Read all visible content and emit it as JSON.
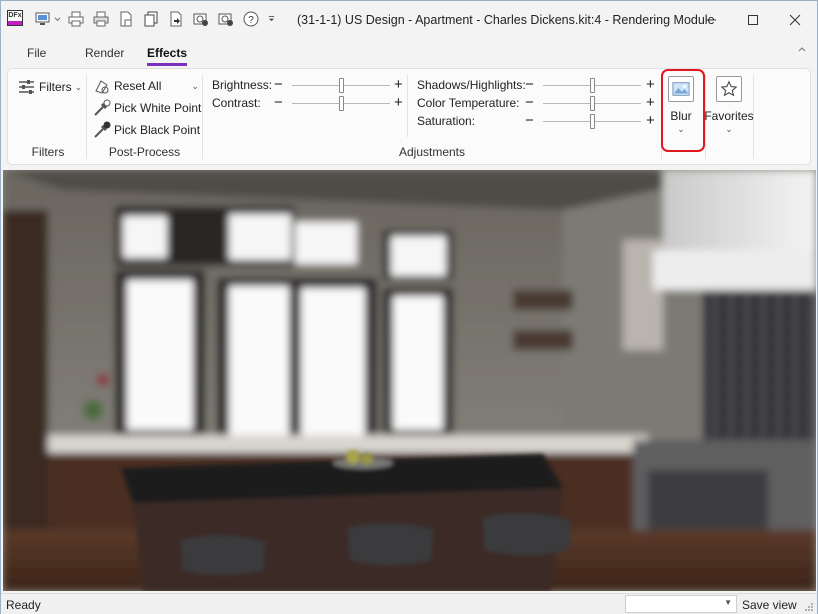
{
  "app": {
    "logo_text": "DFx",
    "window_title": "(31-1-1) US Design - Apartment - Charles Dickens.kit:4 - Rendering Module"
  },
  "quick_access": {
    "icons": [
      "monitor-capture-icon",
      "print-icon",
      "print-setup-icon",
      "document-icon",
      "copy-icon",
      "export-icon",
      "camera-settings-icon",
      "camera-add-icon",
      "help-icon",
      "customize-qat-icon"
    ]
  },
  "tabs": [
    {
      "label": "File",
      "active": false
    },
    {
      "label": "Render",
      "active": false
    },
    {
      "label": "Effects",
      "active": true
    }
  ],
  "ribbon": {
    "filters": {
      "button_label": "Filters",
      "group_label": "Filters"
    },
    "post_process": {
      "reset_all": "Reset All",
      "pick_white": "Pick White Point",
      "pick_black": "Pick Black Point",
      "group_label": "Post-Process"
    },
    "adjustments": {
      "group_label": "Adjustments",
      "brightness": {
        "label": "Brightness:",
        "level": 0.5
      },
      "contrast": {
        "label": "Contrast:",
        "level": 0.5
      },
      "shadows": {
        "label": "Shadows/Highlights:",
        "level": 0.5
      },
      "color_temp": {
        "label": "Color Temperature:",
        "level": 0.5
      },
      "saturation": {
        "label": "Saturation:",
        "level": 0.5
      },
      "minus": "−",
      "plus": "+"
    },
    "blur": {
      "label": "Blur",
      "highlighted": true
    },
    "favorites": {
      "label": "Favorites"
    }
  },
  "status": {
    "text": "Ready",
    "save_view": "Save view"
  },
  "colors": {
    "accent": "#7b2fbf",
    "highlight": "#e0171f",
    "logo_bar": "#c21ec1"
  }
}
